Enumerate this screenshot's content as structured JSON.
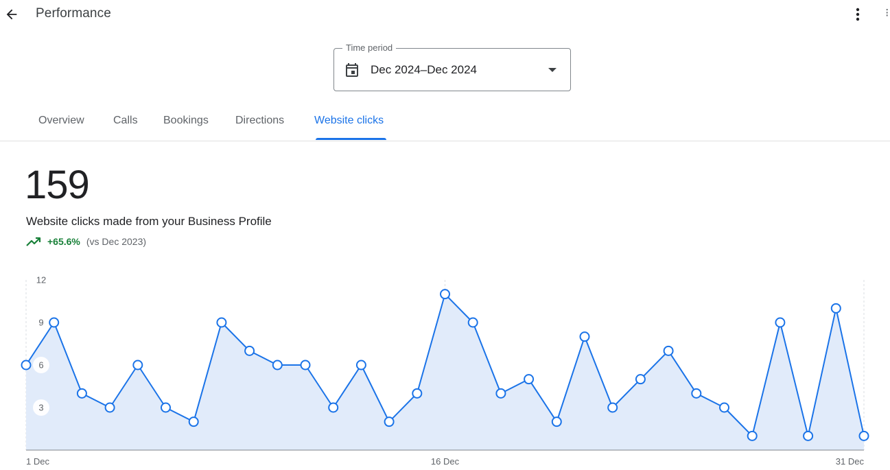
{
  "header": {
    "back_icon": "arrow-back-icon",
    "title": "Performance",
    "more_icon": "more-vert-icon",
    "edge_glyph": "⁝"
  },
  "time_period": {
    "label": "Time period",
    "value": "Dec 2024–Dec 2024",
    "icon": "calendar-icon",
    "dropdown_icon": "arrow-drop-down-icon"
  },
  "tabs": [
    {
      "label": "Overview",
      "active": false
    },
    {
      "label": "Calls",
      "active": false
    },
    {
      "label": "Bookings",
      "active": false
    },
    {
      "label": "Directions",
      "active": false
    },
    {
      "label": "Website clicks",
      "active": true
    }
  ],
  "metric": {
    "value": "159",
    "caption": "Website clicks made from your Business Profile",
    "trend_icon": "trending-up-icon",
    "change": "+65.6%",
    "comparison": "(vs Dec 2023)"
  },
  "colors": {
    "accent": "#1a73e8",
    "positive": "#188038",
    "area_fill": "#e1ebfa"
  },
  "chart_data": {
    "type": "area",
    "x": [
      1,
      2,
      3,
      4,
      5,
      6,
      7,
      8,
      9,
      10,
      11,
      12,
      13,
      14,
      15,
      16,
      17,
      18,
      19,
      20,
      21,
      22,
      23,
      24,
      25,
      26,
      27,
      28,
      29,
      30,
      31
    ],
    "series": [
      {
        "values": [
          6,
          9,
          4,
          3,
          6,
          3,
          2,
          9,
          7,
          6,
          6,
          3,
          6,
          2,
          4,
          11,
          9,
          4,
          5,
          2,
          8,
          3,
          5,
          7,
          4,
          3,
          1,
          9,
          1,
          10,
          1
        ]
      }
    ],
    "y_ticks": [
      "3",
      "6",
      "9",
      "12"
    ],
    "x_tick_labels": [
      {
        "day": 1,
        "label": "1 Dec"
      },
      {
        "day": 16,
        "label": "16 Dec"
      },
      {
        "day": 31,
        "label": "31 Dec"
      }
    ],
    "ylim": [
      0,
      12
    ],
    "grid": "vertical dashed lines at labeled days"
  }
}
